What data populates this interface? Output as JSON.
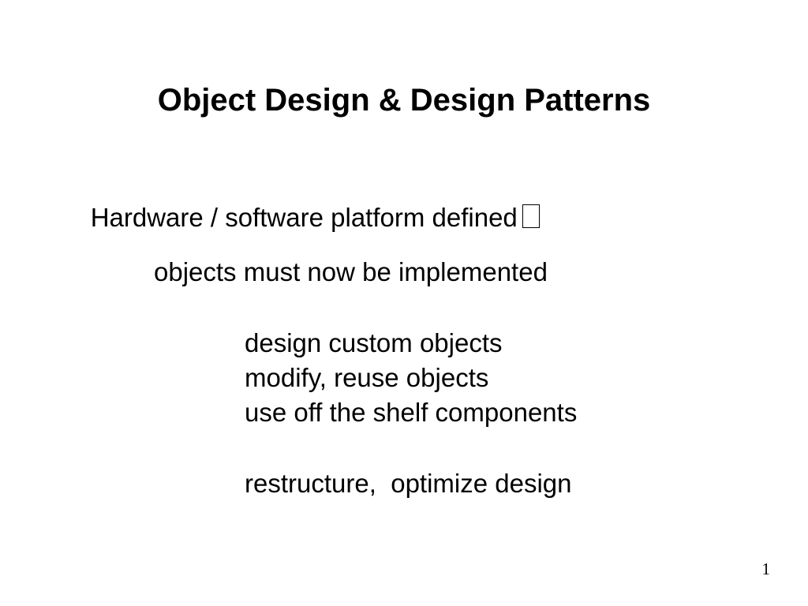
{
  "slide": {
    "title": "Object Design & Design Patterns",
    "line1": "Hardware / software platform defined",
    "line2": "objects must now be implemented",
    "line3": "design custom objects",
    "line4": "modify, reuse objects",
    "line5": "use off the shelf components",
    "line6": "restructure,  optimize design",
    "page_number": "1"
  }
}
